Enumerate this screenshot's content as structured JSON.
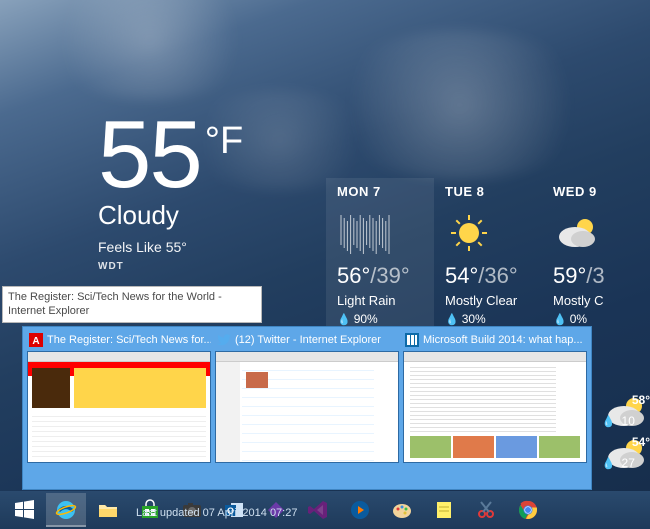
{
  "weather": {
    "temp_value": "55",
    "temp_unit": "°F",
    "condition": "Cloudy",
    "feels_like": "Feels Like 55°",
    "attribution": "WDT"
  },
  "forecast": [
    {
      "label": "MON 7",
      "icon": "rain",
      "hi": "56°",
      "lo": "/39°",
      "cond": "Light Rain",
      "precip": "90%",
      "selected": true
    },
    {
      "label": "TUE 8",
      "icon": "sunny",
      "hi": "54°",
      "lo": "/36°",
      "cond": "Mostly Clear",
      "precip": "30%",
      "selected": false
    },
    {
      "label": "WED 9",
      "icon": "partly",
      "hi": "59°",
      "lo": "/3",
      "cond": "Mostly C",
      "precip": "0%",
      "selected": false
    }
  ],
  "right_extras": [
    {
      "temp": "58°",
      "precip": "10"
    },
    {
      "temp": "54°",
      "precip": "27"
    }
  ],
  "tooltip": "The Register: Sci/Tech News for the World - Internet Explorer",
  "jumplist": [
    {
      "icon": "register",
      "title": "The Register: Sci/Tech News for...",
      "thumbClass": "reg"
    },
    {
      "icon": "twitter",
      "title": "(12) Twitter - Internet Explorer",
      "thumbClass": "tw"
    },
    {
      "icon": "msbuild",
      "title": "Microsoft Build 2014: what hap...",
      "thumbClass": "ms"
    }
  ],
  "taskbar": {
    "items": [
      {
        "name": "start-button",
        "icon": "windows",
        "active": false
      },
      {
        "name": "ie-button",
        "icon": "ie",
        "active": true
      },
      {
        "name": "explorer-button",
        "icon": "folder",
        "active": false
      },
      {
        "name": "store-button",
        "icon": "store",
        "active": false
      },
      {
        "name": "camera-button",
        "icon": "camera",
        "active": false
      },
      {
        "name": "outlook-button",
        "icon": "outlook",
        "active": false
      },
      {
        "name": "devtool-button",
        "icon": "purple",
        "active": false
      },
      {
        "name": "vs-button",
        "icon": "vs",
        "active": false
      },
      {
        "name": "media-button",
        "icon": "media",
        "active": false
      },
      {
        "name": "paint-button",
        "icon": "paint",
        "active": false
      },
      {
        "name": "notes-button",
        "icon": "notes",
        "active": false
      },
      {
        "name": "snip-button",
        "icon": "snip",
        "active": false
      },
      {
        "name": "chrome-button",
        "icon": "chrome",
        "active": false
      }
    ],
    "info": "Last updated 07 April 2014 07:27"
  }
}
